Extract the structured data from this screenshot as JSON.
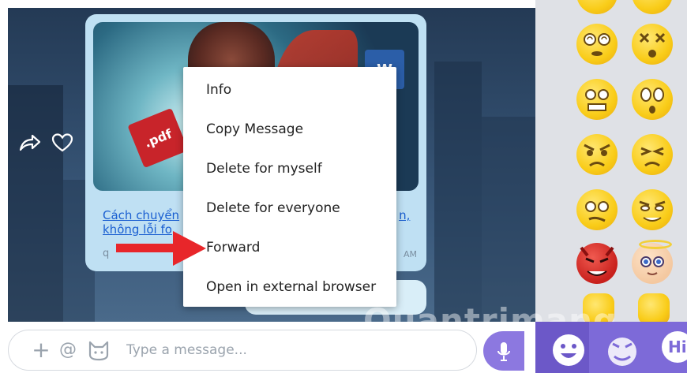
{
  "message": {
    "link_text": "Cách chuyển file Word sang PDF, Word sang PDF không lỗi font",
    "link_visible_start": "Cách chuyển",
    "link_visible_end": "n,",
    "link_line2": "không lỗi fo",
    "sender_fragment": "q",
    "time_fragment": "AM",
    "pdf_label": ".pdf",
    "word_label": "W"
  },
  "context_menu": {
    "items": [
      {
        "id": "info",
        "label": "Info"
      },
      {
        "id": "copy",
        "label": "Copy Message"
      },
      {
        "id": "delete-self",
        "label": "Delete for myself"
      },
      {
        "id": "delete-all",
        "label": "Delete for everyone"
      },
      {
        "id": "forward",
        "label": "Forward"
      },
      {
        "id": "open-browser",
        "label": "Open in external browser"
      }
    ]
  },
  "composer": {
    "placeholder": "Type a message...",
    "plus_glyph": "+",
    "at_glyph": "@"
  },
  "watermark": "Quantrimang",
  "bottom_bar": {
    "hi_label": "Hi"
  },
  "colors": {
    "accent": "#8c78e0",
    "bubble": "#bfe0f3",
    "link": "#1a5fd1",
    "arrow": "#e8262a"
  }
}
